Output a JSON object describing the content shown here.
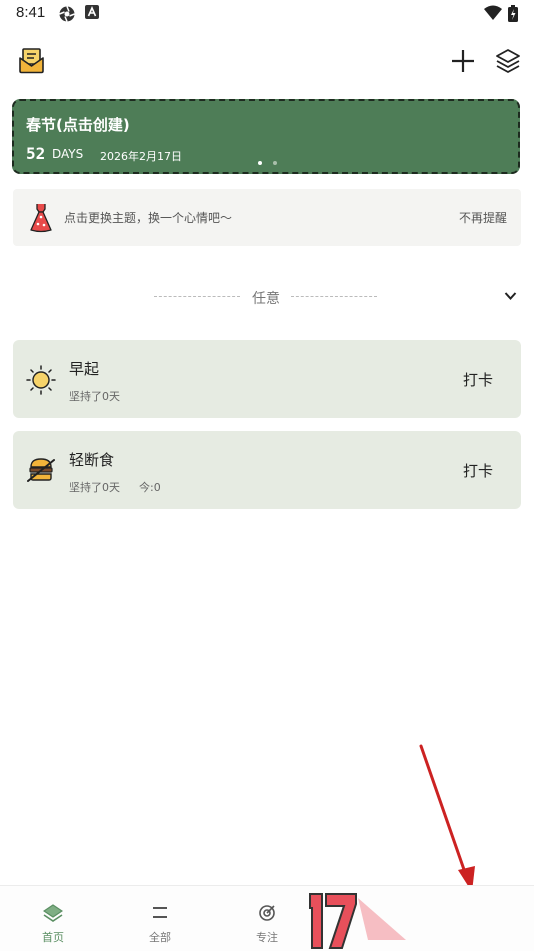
{
  "status_bar": {
    "time": "8:41"
  },
  "banner": {
    "title": "春节(点击创建)",
    "days": "52",
    "days_unit": "DAYS",
    "date": "2026年2月17日"
  },
  "tip": {
    "text": "点击更换主题，换一个心情吧～",
    "dismiss": "不再提醒"
  },
  "section": {
    "title": "任意"
  },
  "habits": [
    {
      "name": "早起",
      "streak": "坚持了0天",
      "today": "",
      "action": "打卡",
      "icon": "sun-icon"
    },
    {
      "name": "轻断食",
      "streak": "坚持了0天",
      "today": "今:0",
      "action": "打卡",
      "icon": "burger-icon"
    }
  ],
  "bottom_nav": {
    "items": [
      {
        "label": "首页",
        "icon": "home-icon",
        "active": true
      },
      {
        "label": "全部",
        "icon": "list-icon"
      },
      {
        "label": "专注",
        "icon": "target-icon"
      }
    ]
  },
  "colors": {
    "banner": "#4e7d57",
    "card": "#e6ebe2",
    "nav_active": "#5b8f63",
    "annotation_arrow": "#cc2222"
  }
}
